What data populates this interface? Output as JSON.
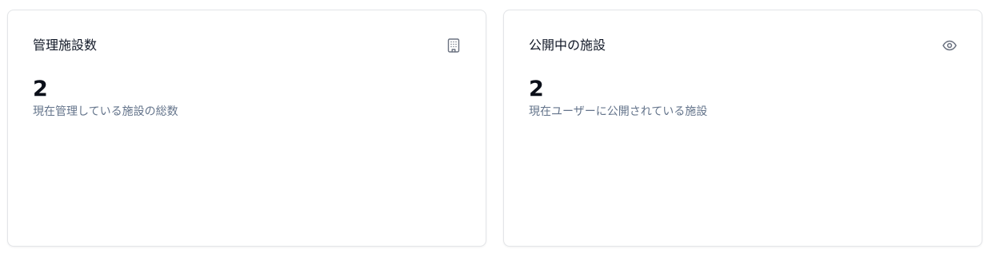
{
  "stats": [
    {
      "title": "管理施設数",
      "value": "2",
      "description": "現在管理している施設の総数",
      "icon": "building-icon"
    },
    {
      "title": "公開中の施設",
      "value": "2",
      "description": "現在ユーザーに公開されている施設",
      "icon": "eye-icon"
    }
  ],
  "colors": {
    "icon": "#6b7280",
    "title": "#111827",
    "value": "#0b0f19",
    "description": "#64748b",
    "border": "#e3e5e8"
  }
}
